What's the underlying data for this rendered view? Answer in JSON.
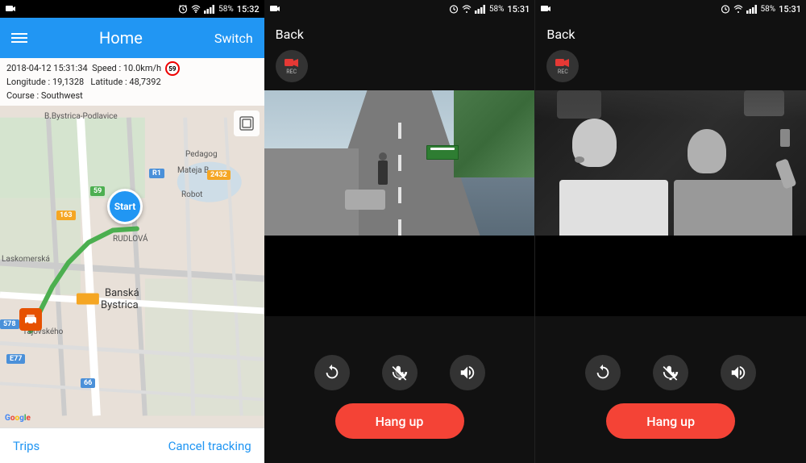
{
  "panel1": {
    "status_bar": {
      "time": "15:32",
      "battery": "58%",
      "icons": [
        "camera-icon",
        "alarm-icon",
        "wifi-icon",
        "signal-icon",
        "battery-icon"
      ]
    },
    "header": {
      "title": "Home",
      "switch_label": "Switch",
      "menu_icon": "menu-icon"
    },
    "info": {
      "datetime": "2018-04-12  15:31:34",
      "speed": "Speed : 10.0km/h",
      "speed_badge": "59",
      "longitude": "Longitude : 19,1328",
      "latitude": "Latitude : 48,7392",
      "course": "Course : Southwest"
    },
    "map": {
      "start_label": "Start",
      "place_labels": [
        "B.Bystrica-Podlavice",
        "Pedagog",
        "Mateja B",
        "RUDLOVÁ",
        "Banská Bystrica",
        "Laskomerská",
        "Tajovského"
      ],
      "road_badges": [
        "163",
        "59",
        "2432",
        "578",
        "E77",
        "66",
        "R1"
      ]
    },
    "bottom_bar": {
      "trips_label": "Trips",
      "cancel_label": "Cancel tracking"
    }
  },
  "panel2": {
    "status_bar": {
      "time": "15:31",
      "battery": "58%"
    },
    "header": {
      "back_label": "Back"
    },
    "rec_label": "REC",
    "controls": {
      "rotate_label": "rotate",
      "mic_label": "mic-off",
      "speaker_label": "speaker"
    },
    "hang_up_label": "Hang up"
  },
  "panel3": {
    "status_bar": {
      "time": "15:31",
      "battery": "58%"
    },
    "header": {
      "back_label": "Back"
    },
    "rec_label": "REC",
    "controls": {
      "rotate_label": "rotate",
      "mic_label": "mic-off",
      "speaker_label": "speaker"
    },
    "hang_up_label": "Hang up"
  }
}
